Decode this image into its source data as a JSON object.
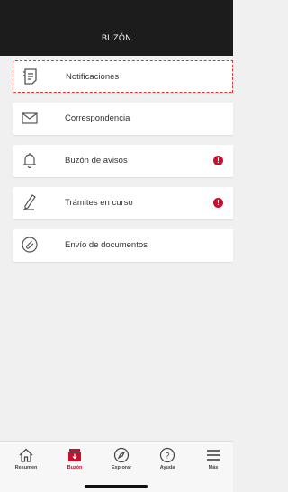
{
  "header": {
    "title": "BUZÓN"
  },
  "items": [
    {
      "label": "Notificaciones",
      "icon": "notification-doc-icon",
      "selected": true,
      "alert": ""
    },
    {
      "label": "Correspondencia",
      "icon": "envelope-icon",
      "selected": false,
      "alert": ""
    },
    {
      "label": "Buzón de avisos",
      "icon": "bell-icon",
      "selected": false,
      "alert": "!"
    },
    {
      "label": "Trámites en curso",
      "icon": "pencil-icon",
      "selected": false,
      "alert": "!"
    },
    {
      "label": "Envío de documentos",
      "icon": "paperclip-icon",
      "selected": false,
      "alert": ""
    }
  ],
  "tabs": [
    {
      "label": "Resumen",
      "icon": "home-icon",
      "active": false
    },
    {
      "label": "Buzón",
      "icon": "mailbox-icon",
      "active": true
    },
    {
      "label": "Explorar",
      "icon": "compass-icon",
      "active": false
    },
    {
      "label": "Ayuda",
      "icon": "help-icon",
      "active": false
    },
    {
      "label": "Más",
      "icon": "menu-icon",
      "active": false
    }
  ],
  "colors": {
    "accent": "#c8102e",
    "header_bg": "#1c1c1c",
    "selection_border": "#d63a3a"
  }
}
